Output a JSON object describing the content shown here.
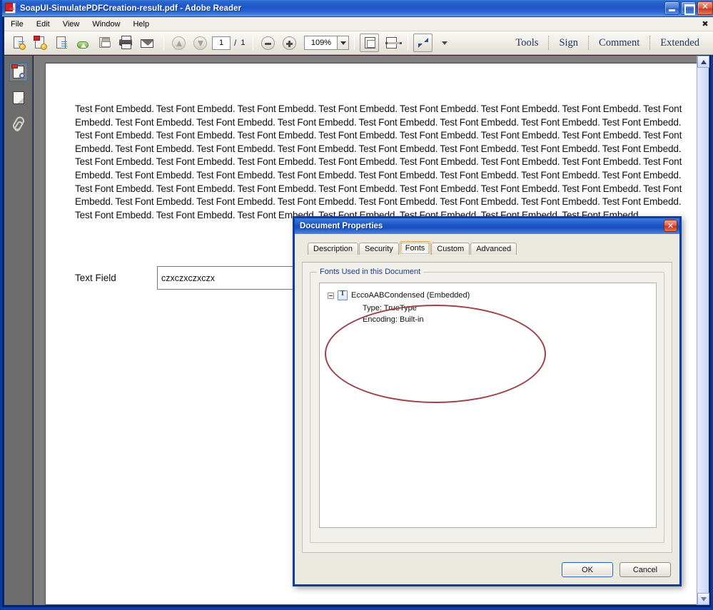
{
  "window": {
    "title": "SoapUI-SimulatePDFCreation-result.pdf  -  Adobe Reader",
    "app_icon": "pdf-document-icon",
    "minimize_label": "Minimize",
    "maximize_label": "Maximize",
    "close_label": "Close"
  },
  "menu": {
    "items": [
      {
        "label": "File"
      },
      {
        "label": "Edit"
      },
      {
        "label": "View"
      },
      {
        "label": "Window"
      },
      {
        "label": "Help"
      }
    ],
    "close_x": "✖"
  },
  "toolbar": {
    "left_icons": [
      {
        "name": "open-file-icon",
        "title": "Open"
      },
      {
        "name": "create-pdf-icon",
        "title": "Create PDF"
      },
      {
        "name": "edit-pdf-icon",
        "title": "Edit"
      },
      {
        "name": "upload-cloud-icon",
        "title": "Send files"
      },
      {
        "name": "save-icon",
        "title": "Save"
      },
      {
        "name": "print-icon",
        "title": "Print"
      },
      {
        "name": "email-icon",
        "title": "Email"
      }
    ],
    "prev_page_icon": "arrow-up-icon",
    "next_page_icon": "arrow-down-icon",
    "page_current": "1",
    "page_separator": "/",
    "page_total": "1",
    "zoom_out_icon": "minus-circle-icon",
    "zoom_in_icon": "plus-circle-icon",
    "zoom_value": "109%",
    "zoom_dropdown_icon": "chevron-down-icon",
    "fit_page_icon": "fit-page-icon",
    "fit_width_icon": "fit-width-icon",
    "read_mode_icon": "expand-arrows-icon",
    "overflow_icon": "chevron-down-icon",
    "text_buttons": [
      {
        "label": "Tools"
      },
      {
        "label": "Sign"
      },
      {
        "label": "Comment"
      },
      {
        "label": "Extended"
      }
    ]
  },
  "left_pane": {
    "items": [
      {
        "name": "page-thumbnails-search-icon",
        "label": "Page Thumbnails",
        "active": true
      },
      {
        "name": "pages-icon",
        "label": "Pages",
        "active": false
      },
      {
        "name": "attachments-paperclip-icon",
        "label": "Attachments",
        "active": false
      }
    ]
  },
  "document": {
    "body_text": "Test Font Embedd. Test Font Embedd. Test Font Embedd. Test Font Embedd. Test Font Embedd. Test Font Embedd. Test Font Embedd. Test Font Embedd. Test Font Embedd. Test Font Embedd. Test Font Embedd. Test Font Embedd. Test Font Embedd. Test Font Embedd. Test Font Embedd. Test Font Embedd. Test Font Embedd. Test Font Embedd. Test Font Embedd. Test Font Embedd. Test Font Embedd. Test Font Embedd. Test Font Embedd. Test Font Embedd. Test Font Embedd. Test Font Embedd. Test Font Embedd. Test Font Embedd. Test Font Embedd. Test Font Embedd. Test Font Embedd. Test Font Embedd. Test Font Embedd. Test Font Embedd. Test Font Embedd. Test Font Embedd. Test Font Embedd. Test Font Embedd. Test Font Embedd. Test Font Embedd. Test Font Embedd. Test Font Embedd. Test Font Embedd. Test Font Embedd. Test Font Embedd. Test Font Embedd. Test Font Embedd. Test Font Embedd. Test Font Embedd. Test Font Embedd. Test Font Embedd. Test Font Embedd. Test Font Embedd. Test Font Embedd. Test Font Embedd. Test Font Embedd. Test Font Embedd. Test Font Embedd. Test Font Embedd. Test Font Embedd. Test Font Embedd. Test Font Embedd. Test Font Embedd. Test Font Embedd. Test Font Embedd. Test Font Embedd. Test Font Embedd.",
    "field_label": "Text Field",
    "field_value": "czxczxczxczx",
    "field_placeholder": ""
  },
  "scrollbar": {
    "up_icon": "chevron-up-icon",
    "down_icon": "chevron-down-icon"
  },
  "dialog": {
    "title": "Document Properties",
    "close_label": "Close",
    "tabs": [
      {
        "label": "Description",
        "selected": false
      },
      {
        "label": "Security",
        "selected": false
      },
      {
        "label": "Fonts",
        "selected": true
      },
      {
        "label": "Custom",
        "selected": false
      },
      {
        "label": "Advanced",
        "selected": false
      }
    ],
    "group_title": "Fonts Used in this Document",
    "font_tree": {
      "root_label": "EccoAABCondensed (Embedded)",
      "root_icon": "truetype-font-icon",
      "expander": "collapse-minus-icon",
      "details": [
        {
          "label": "Type: TrueType"
        },
        {
          "label": "Encoding: Built-in"
        }
      ]
    },
    "annotation": {
      "shape": "ellipse",
      "color": "#9e4048"
    },
    "buttons": [
      {
        "label": "OK",
        "default": true
      },
      {
        "label": "Cancel",
        "default": false
      }
    ]
  },
  "colors": {
    "title_bar_blue": "#1d55c5",
    "dialog_border_blue": "#0b3ea8",
    "selected_tab_orange": "#e8a33d",
    "annotation_red": "#9e4048",
    "toolbar_text_blue": "#1f3864",
    "group_label_blue": "#1c3f94"
  }
}
